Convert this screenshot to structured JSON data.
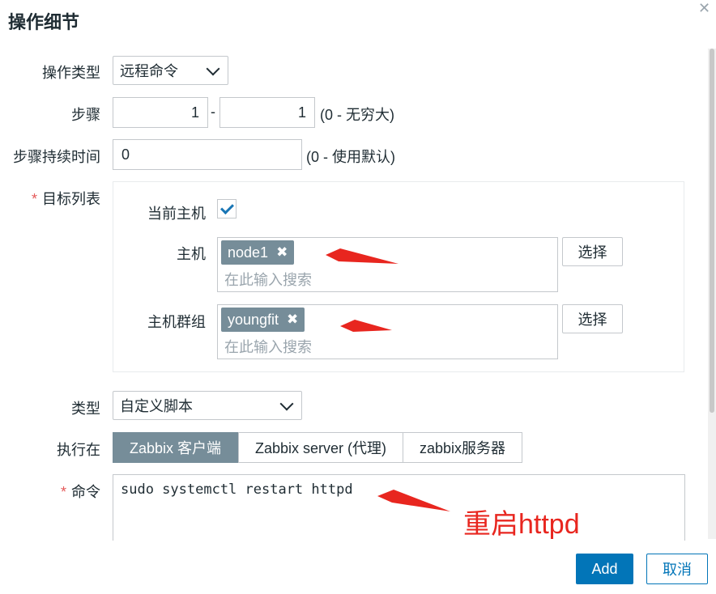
{
  "dialog": {
    "title": "操作细节"
  },
  "fields": {
    "operation_type": {
      "label": "操作类型",
      "value": "远程命令"
    },
    "steps": {
      "label": "步骤",
      "from": "1",
      "sep": "-",
      "to": "1",
      "hint": "(0 - 无穷大)"
    },
    "step_duration": {
      "label": "步骤持续时间",
      "value": "0",
      "hint": "(0 - 使用默认)"
    },
    "target_list": {
      "label": "目标列表",
      "current_host_label": "当前主机",
      "current_host_checked": true,
      "host": {
        "label": "主机",
        "tag": "node1",
        "placeholder": "在此输入搜索",
        "select_label": "选择"
      },
      "host_group": {
        "label": "主机群组",
        "tag": "youngfit",
        "placeholder": "在此输入搜索",
        "select_label": "选择"
      }
    },
    "type": {
      "label": "类型",
      "value": "自定义脚本"
    },
    "execute_on": {
      "label": "执行在",
      "options": [
        "Zabbix 客户端",
        "Zabbix server (代理)",
        "zabbix服务器"
      ],
      "selected": "Zabbix 客户端"
    },
    "command": {
      "label": "命令",
      "value": "sudo systemctl restart httpd"
    }
  },
  "buttons": {
    "add": "Add",
    "cancel": "取消"
  },
  "annotation": {
    "text": "重启httpd"
  },
  "icons": {
    "close": "close-icon",
    "remove": "remove-tag-icon",
    "check": "checkmark-icon",
    "dropdown": "chevron-down-icon"
  },
  "colors": {
    "primary": "#0275b8",
    "tag": "#768d99",
    "annotation": "#e8261f",
    "required": "#e45959"
  }
}
